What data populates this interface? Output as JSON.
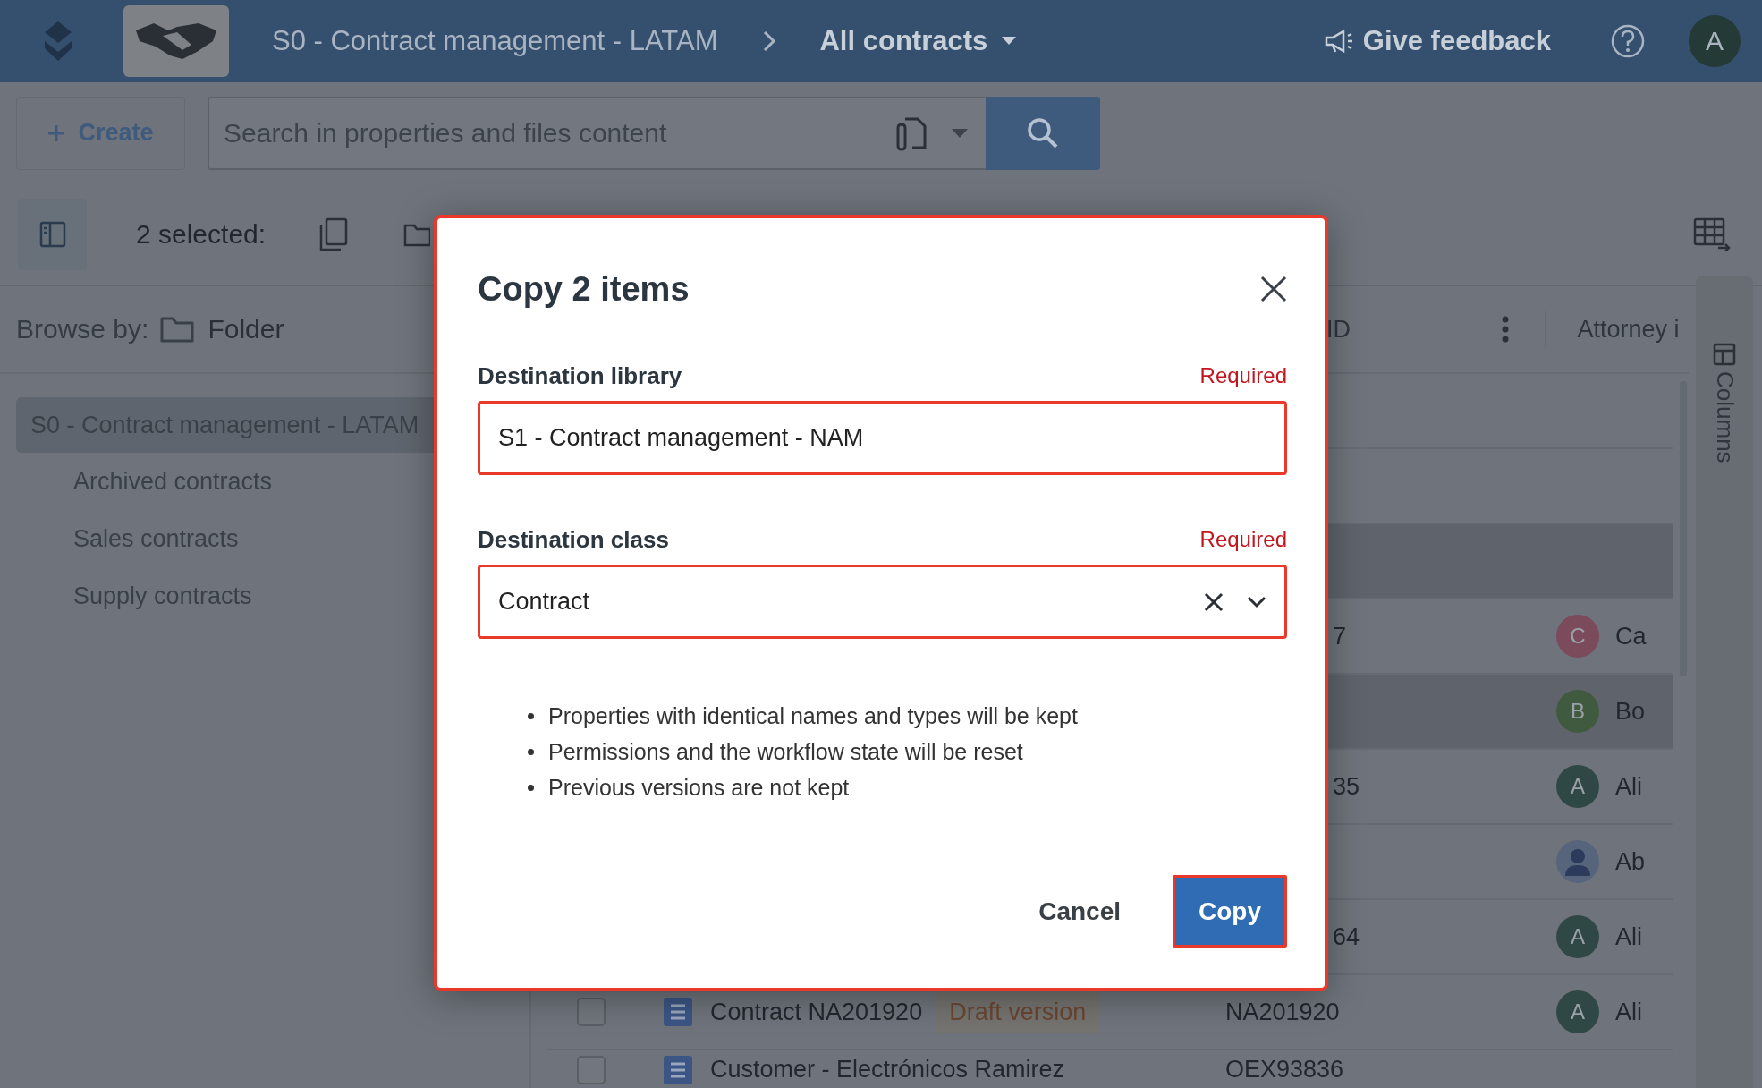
{
  "top_bar": {
    "breadcrumb": "S0 - Contract management - LATAM",
    "view": "All contracts",
    "feedback": "Give feedback",
    "avatar": "A"
  },
  "toolbar": {
    "create": "Create",
    "search": {
      "placeholder": "Search in properties and files content"
    }
  },
  "selection_bar": {
    "label": "2 selected:"
  },
  "browse": {
    "label": "Browse by:",
    "value": "Folder"
  },
  "tree": [
    {
      "label": "S0 - Contract management - LATAM",
      "selected": true,
      "children": [
        {
          "label": "Archived contracts",
          "selected": false
        },
        {
          "label": "Sales contracts",
          "selected": false
        },
        {
          "label": "Supply contracts",
          "selected": false
        }
      ]
    }
  ],
  "table": {
    "columns": [
      {
        "label": "ID"
      },
      {
        "label": "Attorney i"
      }
    ],
    "rows": [
      {
        "selected": false
      },
      {
        "selected": false
      },
      {
        "selected": true
      },
      {
        "selected": false,
        "id_tail": "7",
        "attorney": {
          "kind": "letter",
          "initial": "C",
          "name": "Ca",
          "color": "#7b4a5b"
        }
      },
      {
        "selected": true,
        "attorney": {
          "kind": "letter",
          "initial": "B",
          "name": "Bo",
          "color": "#405a3f"
        }
      },
      {
        "selected": false,
        "id_tail": "35",
        "attorney": {
          "kind": "letter",
          "initial": "A",
          "name": "Ali",
          "color": "#2f4846"
        }
      },
      {
        "selected": false,
        "attorney": {
          "kind": "person",
          "name": "Ab",
          "color": "#56657c"
        }
      },
      {
        "selected": false,
        "id_tail": "64",
        "attorney": {
          "kind": "letter",
          "initial": "A",
          "name": "Ali",
          "color": "#2f4846"
        }
      },
      {
        "selected": false,
        "checked": false,
        "name": "Contract NA201920",
        "tag": "Draft version",
        "id": "NA201920",
        "attorney": {
          "kind": "letter",
          "initial": "A",
          "name": "Ali",
          "color": "#2f4846"
        }
      },
      {
        "selected": false,
        "checked": false,
        "name": "Customer - Electrónicos Ramirez",
        "id": "OEX93836"
      }
    ]
  },
  "side_panel": {
    "label": "Columns"
  },
  "dialog": {
    "title": "Copy 2 items",
    "fields": [
      {
        "label": "Destination library",
        "required": "Required",
        "value": "S1 - Contract management - NAM",
        "kind": "text"
      },
      {
        "label": "Destination class",
        "required": "Required",
        "value": "Contract",
        "kind": "select"
      }
    ],
    "notes": [
      "Properties with identical names and types will be kept",
      "Permissions and the workflow state will be reset",
      "Previous versions are not kept"
    ],
    "buttons": [
      {
        "label": "Cancel",
        "kind": "secondary"
      },
      {
        "label": "Copy",
        "kind": "primary"
      }
    ]
  }
}
